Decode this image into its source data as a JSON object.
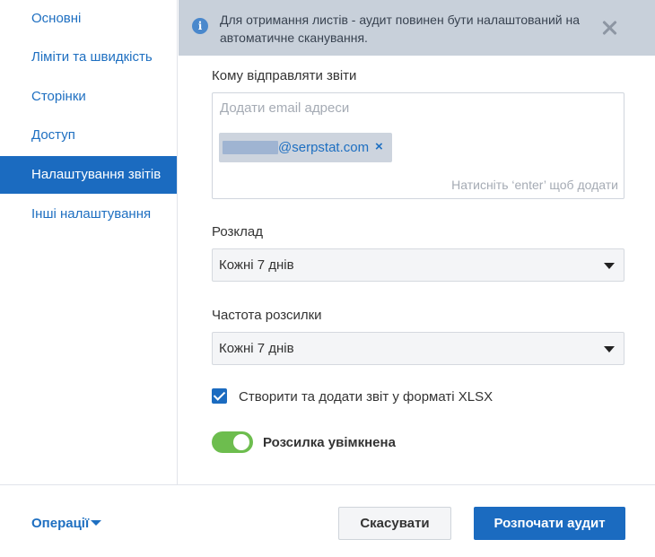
{
  "sidebar": {
    "items": [
      {
        "label": "Основні"
      },
      {
        "label": "Ліміти та швидкість"
      },
      {
        "label": "Сторінки"
      },
      {
        "label": "Доступ"
      },
      {
        "label": "Налаштування звітів",
        "active": true
      },
      {
        "label": "Інші налаштування"
      }
    ]
  },
  "alert": {
    "icon": "info-icon",
    "icon_glyph": "i",
    "text": "Для отримання листів - аудит повинен бути налаштований на автоматичне сканування."
  },
  "recipients": {
    "label": "Кому відправляти звіти",
    "placeholder": "Додати email адреси",
    "chip_text": "@serpstat.com",
    "chip_remove": "×",
    "hint": "Натисніть ‘enter’ щоб додати"
  },
  "schedule": {
    "label": "Розклад",
    "value": "Кожні 7 днів"
  },
  "frequency": {
    "label": "Частота розсилки",
    "value": "Кожні 7 днів"
  },
  "xlsx": {
    "label": "Створити та додати звіт у форматі XLSX",
    "checked": true
  },
  "mailing": {
    "label": "Розсилка увімкнена",
    "enabled": true
  },
  "footer": {
    "operations_label": "Операції",
    "cancel_label": "Скасувати",
    "start_label": "Розпочати аудит"
  },
  "colors": {
    "accent": "#1b6bc0",
    "link": "#1e6fc1",
    "alert_bg": "#c8d0da",
    "toggle_on": "#6dbd4e"
  }
}
